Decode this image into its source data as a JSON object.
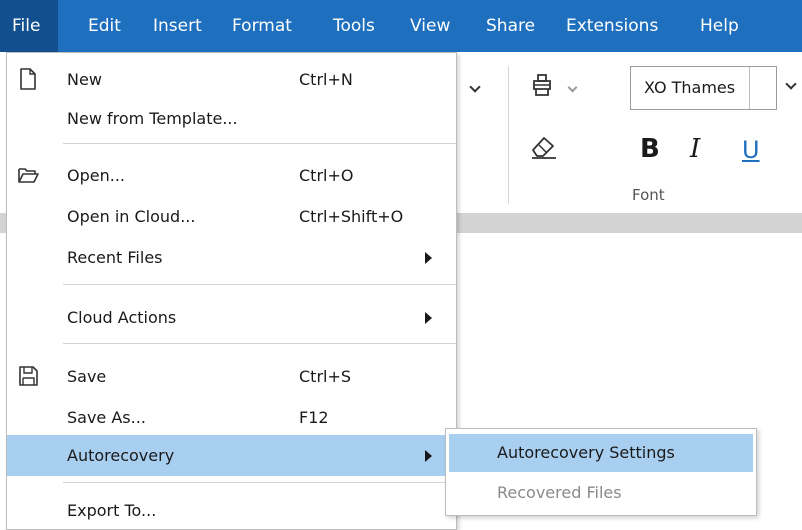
{
  "menubar": {
    "items": [
      {
        "label": "File",
        "active": true
      },
      {
        "label": "Edit"
      },
      {
        "label": "Insert"
      },
      {
        "label": "Format"
      },
      {
        "label": "Tools"
      },
      {
        "label": "View"
      },
      {
        "label": "Share"
      },
      {
        "label": "Extensions"
      },
      {
        "label": "Help"
      }
    ]
  },
  "ribbon": {
    "font_name": "XO Thames",
    "format_buttons": {
      "bold": "B",
      "italic": "I",
      "underline": "U"
    },
    "group_label": "Font"
  },
  "file_menu": {
    "items": [
      {
        "label": "New",
        "shortcut": "Ctrl+N",
        "icon": "new-file-icon"
      },
      {
        "label": "New from Template...",
        "shortcut": ""
      },
      {
        "label": "Open...",
        "shortcut": "Ctrl+O",
        "icon": "open-folder-icon"
      },
      {
        "label": "Open in Cloud...",
        "shortcut": "Ctrl+Shift+O"
      },
      {
        "label": "Recent Files",
        "submenu": true
      },
      {
        "label": "Cloud Actions",
        "submenu": true
      },
      {
        "label": "Save",
        "shortcut": "Ctrl+S",
        "icon": "save-icon"
      },
      {
        "label": "Save As...",
        "shortcut": "F12"
      },
      {
        "label": "Autorecovery",
        "submenu": true,
        "highlighted": true
      },
      {
        "label": "Export To...",
        "shortcut": ""
      }
    ]
  },
  "autorecovery_submenu": {
    "items": [
      {
        "label": "Autorecovery Settings",
        "highlighted": true,
        "enabled": true
      },
      {
        "label": "Recovered Files",
        "enabled": false
      }
    ]
  },
  "colors": {
    "menubar_bg": "#1f6fbf",
    "menubar_active": "#114f8e",
    "highlight": "#a8cff0",
    "ribbon_strip": "#d3d3d3"
  }
}
